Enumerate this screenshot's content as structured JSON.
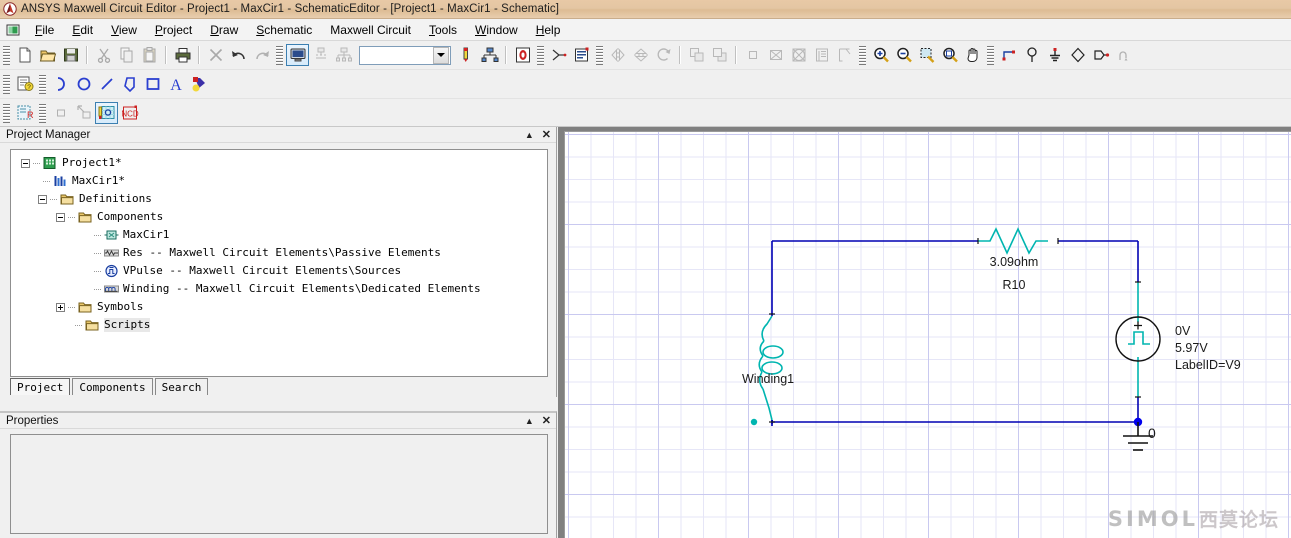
{
  "window": {
    "title": "ANSYS Maxwell Circuit Editor - Project1 - MaxCir1 - SchematicEditor - [Project1 - MaxCir1 - Schematic]",
    "app_icon": "ansys-logo-icon"
  },
  "menubar": {
    "system_icon": "system-menu-icon",
    "items": [
      {
        "label": "File"
      },
      {
        "label": "Edit"
      },
      {
        "label": "View"
      },
      {
        "label": "Project"
      },
      {
        "label": "Draw"
      },
      {
        "label": "Schematic"
      },
      {
        "label": "Maxwell Circuit"
      },
      {
        "label": "Tools"
      },
      {
        "label": "Window"
      },
      {
        "label": "Help"
      }
    ]
  },
  "toolbars": {
    "row1": [
      {
        "type": "grip",
        "name": "toolbar-grip"
      },
      {
        "type": "btn",
        "name": "new-document-icon",
        "icon": "new"
      },
      {
        "type": "btn",
        "name": "open-folder-icon",
        "icon": "open"
      },
      {
        "type": "btn",
        "name": "save-icon",
        "icon": "save"
      },
      {
        "type": "sep"
      },
      {
        "type": "btn",
        "name": "cut-scissors-icon",
        "icon": "cut",
        "disabled": true
      },
      {
        "type": "btn",
        "name": "copy-icon",
        "icon": "copy",
        "disabled": true
      },
      {
        "type": "btn",
        "name": "paste-icon",
        "icon": "paste",
        "disabled": true
      },
      {
        "type": "sep"
      },
      {
        "type": "btn",
        "name": "print-icon",
        "icon": "print"
      },
      {
        "type": "sep"
      },
      {
        "type": "btn",
        "name": "delete-x-icon",
        "icon": "bigx",
        "disabled": true
      },
      {
        "type": "btn",
        "name": "undo-icon",
        "icon": "undo"
      },
      {
        "type": "btn",
        "name": "redo-icon",
        "icon": "redo",
        "disabled": true
      },
      {
        "type": "grip",
        "name": "toolbar-grip"
      },
      {
        "type": "btn",
        "name": "validate-monitor-icon",
        "icon": "monitor",
        "selected": true
      },
      {
        "type": "btn",
        "name": "analyze-icon",
        "icon": "analyze",
        "disabled": true
      },
      {
        "type": "btn",
        "name": "distribute-icon",
        "icon": "distribute",
        "disabled": true
      },
      {
        "type": "combo",
        "name": "design-selector-combo",
        "value": ""
      },
      {
        "type": "btn",
        "name": "measure-probe-icon",
        "icon": "probe"
      },
      {
        "type": "btn",
        "name": "network-icon",
        "icon": "network"
      },
      {
        "type": "sep"
      },
      {
        "type": "btn",
        "name": "ansys-help-icon",
        "icon": "ansys"
      },
      {
        "type": "grip",
        "name": "toolbar-grip"
      },
      {
        "type": "btn",
        "name": "cut-wire-icon",
        "icon": "cutwire"
      },
      {
        "type": "btn",
        "name": "edit-properties-icon",
        "icon": "editprops"
      },
      {
        "type": "grip",
        "name": "toolbar-grip"
      },
      {
        "type": "btn",
        "name": "mirror-horizontal-icon",
        "icon": "mirrorh",
        "disabled": true
      },
      {
        "type": "btn",
        "name": "mirror-vertical-icon",
        "icon": "mirrorv",
        "disabled": true
      },
      {
        "type": "btn",
        "name": "rotate-icon",
        "icon": "rotate",
        "disabled": true
      },
      {
        "type": "sep"
      },
      {
        "type": "btn",
        "name": "bring-to-front-icon",
        "icon": "front",
        "disabled": true
      },
      {
        "type": "btn",
        "name": "send-to-back-icon",
        "icon": "back",
        "disabled": true
      },
      {
        "type": "sep"
      },
      {
        "type": "btn",
        "name": "select-object-icon",
        "icon": "selobj",
        "disabled": true
      },
      {
        "type": "btn",
        "name": "deselect-icon",
        "icon": "deselect",
        "disabled": true
      },
      {
        "type": "btn",
        "name": "select-all-icon",
        "icon": "selall",
        "disabled": true
      },
      {
        "type": "btn",
        "name": "list-icon",
        "icon": "list",
        "disabled": true
      },
      {
        "type": "btn",
        "name": "corner-icon",
        "icon": "corner",
        "disabled": true
      },
      {
        "type": "grip",
        "name": "toolbar-grip"
      },
      {
        "type": "btn",
        "name": "zoom-in-icon",
        "icon": "zoomin"
      },
      {
        "type": "btn",
        "name": "zoom-out-icon",
        "icon": "zoomout"
      },
      {
        "type": "btn",
        "name": "fit-selection-icon",
        "icon": "fitsel"
      },
      {
        "type": "btn",
        "name": "fit-all-icon",
        "icon": "fitall"
      },
      {
        "type": "btn",
        "name": "pan-hand-icon",
        "icon": "pan"
      },
      {
        "type": "grip",
        "name": "toolbar-grip"
      },
      {
        "type": "btn",
        "name": "draw-wire-icon",
        "icon": "wire"
      },
      {
        "type": "btn",
        "name": "place-port-icon",
        "icon": "port"
      },
      {
        "type": "btn",
        "name": "place-ground-icon",
        "icon": "ground"
      },
      {
        "type": "btn",
        "name": "place-node-icon",
        "icon": "node"
      },
      {
        "type": "btn",
        "name": "place-pin-icon",
        "icon": "pin"
      },
      {
        "type": "btn",
        "name": "page-connector-icon",
        "icon": "pageconn"
      }
    ],
    "row2": [
      {
        "type": "grip",
        "name": "toolbar-grip"
      },
      {
        "type": "btn",
        "name": "component-help-icon",
        "icon": "comphelp"
      },
      {
        "type": "grip",
        "name": "toolbar-grip"
      },
      {
        "type": "btn",
        "name": "draw-arc-icon",
        "icon": "arc"
      },
      {
        "type": "btn",
        "name": "draw-circle-icon",
        "icon": "circle"
      },
      {
        "type": "btn",
        "name": "draw-line-icon",
        "icon": "line"
      },
      {
        "type": "btn",
        "name": "draw-polygon-icon",
        "icon": "polygon"
      },
      {
        "type": "btn",
        "name": "draw-rectangle-icon",
        "icon": "rectangle"
      },
      {
        "type": "btn",
        "name": "draw-text-icon",
        "icon": "text"
      },
      {
        "type": "btn",
        "name": "fill-color-icon",
        "icon": "fill"
      }
    ],
    "row3": [
      {
        "type": "grip",
        "name": "toolbar-grip"
      },
      {
        "type": "btn",
        "name": "edit-symbol-icon",
        "icon": "editsym"
      },
      {
        "type": "grip",
        "name": "toolbar-grip"
      },
      {
        "type": "btn",
        "name": "symbol-box-icon",
        "icon": "sbox",
        "disabled": true
      },
      {
        "type": "btn",
        "name": "resize-symbol-icon",
        "icon": "sresize",
        "disabled": true
      },
      {
        "type": "btn",
        "name": "symbol-pin-icon",
        "icon": "spin",
        "selected": true
      },
      {
        "type": "btn",
        "name": "symbol-label-icon",
        "icon": "slabel"
      }
    ]
  },
  "project_manager": {
    "caption": "Project Manager",
    "collapse_icon": "collapse-icon",
    "close_icon": "close-icon",
    "tree": [
      {
        "label": "Project1*",
        "indent": 0,
        "expander": "minus",
        "icon": "project-icon"
      },
      {
        "label": "MaxCir1*",
        "indent": 1,
        "expander": "none",
        "icon": "design-icon"
      },
      {
        "label": "Definitions",
        "indent": 1,
        "expander": "minus",
        "icon": "folder-icon"
      },
      {
        "label": "Components",
        "indent": 2,
        "expander": "minus",
        "icon": "folder-icon"
      },
      {
        "label": "MaxCir1",
        "indent": 3,
        "expander": "none",
        "icon": "component-icon"
      },
      {
        "label": "Res -- Maxwell Circuit Elements\\Passive Elements",
        "indent": 3,
        "expander": "none",
        "icon": "resistor-icon"
      },
      {
        "label": "VPulse -- Maxwell Circuit Elements\\Sources",
        "indent": 3,
        "expander": "none",
        "icon": "source-icon"
      },
      {
        "label": "Winding -- Maxwell Circuit Elements\\Dedicated Elements",
        "indent": 3,
        "expander": "none",
        "icon": "winding-icon"
      },
      {
        "label": "Symbols",
        "indent": 2,
        "expander": "plus",
        "icon": "folder-icon"
      },
      {
        "label": "Scripts",
        "indent": 2,
        "expander": "none",
        "icon": "folder-icon",
        "selected": true
      }
    ],
    "tabs": [
      {
        "label": "Project",
        "active": true
      },
      {
        "label": "Components",
        "active": false
      },
      {
        "label": "Search",
        "active": false
      }
    ]
  },
  "properties": {
    "caption": "Properties",
    "collapse_icon": "collapse-icon",
    "close_icon": "close-icon"
  },
  "schematic": {
    "colors": {
      "wire": "#0000b4",
      "component": "#00b5b0",
      "grid_minor": "#e6e6f7",
      "grid_major": "#c9c9f0",
      "text": "#1a1a1a",
      "junction": "#0000ee"
    },
    "components": [
      {
        "name": "resistor",
        "symbol": "resistor-symbol",
        "labels": [
          "3.09ohm",
          "R10"
        ]
      },
      {
        "name": "winding",
        "symbol": "winding-symbol",
        "labels": [
          "Winding1"
        ]
      },
      {
        "name": "voltage-pulse-source",
        "symbol": "vpulse-symbol",
        "polarity": "+",
        "labels": [
          "0V",
          "5.97V",
          "LabelID=V9"
        ]
      },
      {
        "name": "ground",
        "symbol": "ground-symbol",
        "labels": [
          "0"
        ]
      }
    ],
    "texts": {
      "resistor_value": "3.09ohm",
      "resistor_refdes": "R10",
      "winding_label": "Winding1",
      "source_v1": "0V",
      "source_v2": "5.97V",
      "source_labelid": "LabelID=V9",
      "ground_label": "0",
      "source_polarity": "+"
    }
  },
  "watermark": {
    "latin": "SIMOL",
    "cjk": "西莫论坛"
  }
}
